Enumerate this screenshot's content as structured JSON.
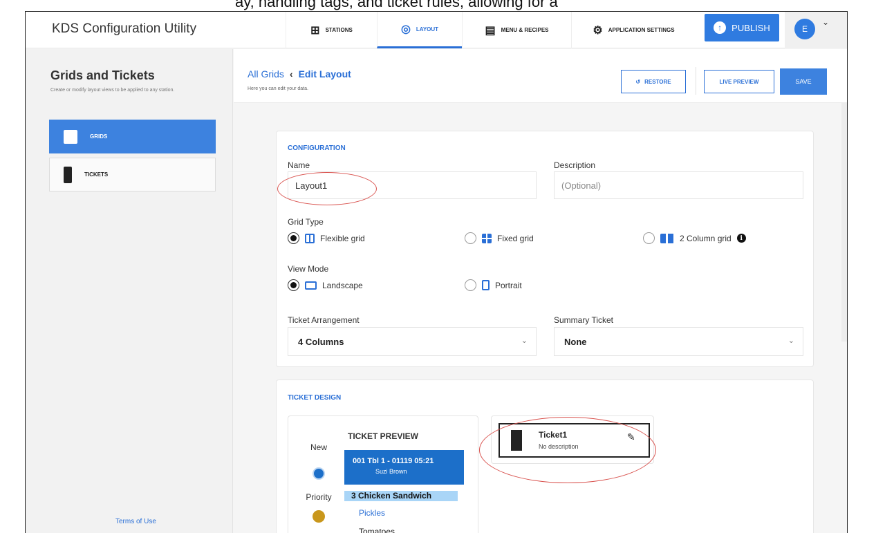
{
  "app": {
    "title": "KDS Configuration Utility"
  },
  "nav": {
    "tabs": [
      {
        "label": "STATIONS",
        "icon": "stations-icon"
      },
      {
        "label": "LAYOUT",
        "icon": "palette-icon",
        "active": true
      },
      {
        "label": "MENU & RECIPES",
        "icon": "menu-book-icon"
      },
      {
        "label": "APPLICATION SETTINGS",
        "icon": "gear-icon"
      }
    ],
    "publish_label": "PUBLISH",
    "avatar_letter": "E"
  },
  "sidebar": {
    "title": "Grids and Tickets",
    "subtitle": "Create or modify layout views to be applied to any station.",
    "items": [
      {
        "label": "GRIDS",
        "icon": "grid-icon",
        "active": true
      },
      {
        "label": "TICKETS",
        "icon": "ticket-icon"
      }
    ],
    "terms_label": "Terms of Use"
  },
  "subheader": {
    "crumb_root": "All Grids",
    "crumb_current": "Edit Layout",
    "subtitle": "Here you can edit your data.",
    "restore_label": "RESTORE",
    "live_preview_label": "LIVE PREVIEW",
    "save_label": "SAVE"
  },
  "configuration": {
    "section_title": "CONFIGURATION",
    "name_label": "Name",
    "name_value": "Layout1",
    "description_label": "Description",
    "description_placeholder": "(Optional)",
    "grid_type_label": "Grid Type",
    "grid_types": [
      {
        "label": "Flexible grid",
        "selected": true
      },
      {
        "label": "Fixed grid",
        "selected": false
      },
      {
        "label": "2 Column grid",
        "selected": false
      }
    ],
    "view_mode_label": "View Mode",
    "view_modes": [
      {
        "label": "Landscape",
        "selected": true
      },
      {
        "label": "Portrait",
        "selected": false
      }
    ],
    "ticket_arrangement_label": "Ticket Arrangement",
    "ticket_arrangement_value": "4 Columns",
    "summary_ticket_label": "Summary Ticket",
    "summary_ticket_value": "None"
  },
  "ticket_design": {
    "section_title": "TICKET DESIGN",
    "preview_title": "TICKET PREVIEW",
    "states": [
      {
        "label": "New",
        "color": "#1c6fc9"
      },
      {
        "label": "Priority",
        "color": "#c9971c"
      }
    ],
    "ticket": {
      "line1": "001   Tbl 1 - 01119   05:21",
      "line2": "Suzi Brown",
      "item": "3   Chicken Sandwich",
      "mod1": "Pickles",
      "mod2": "Tomatoes"
    },
    "card": {
      "name": "Ticket1",
      "description": "No description"
    }
  },
  "colors": {
    "accent": "#2a6fd6",
    "annotation": "#d9534f"
  }
}
